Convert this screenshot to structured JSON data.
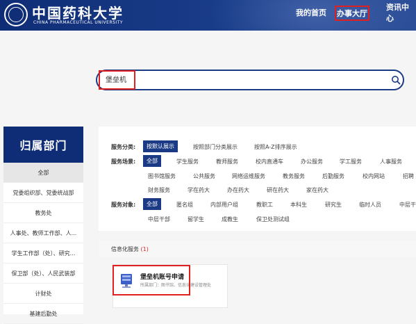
{
  "header": {
    "logo_cn": "中国药科大学",
    "logo_en": "CHINA PHARMACEUTICAL UNIVERSITY",
    "nav": [
      "我的首页",
      "办事大厅",
      "资讯中心"
    ]
  },
  "search": {
    "value": "堡垒机"
  },
  "sidebar": {
    "title": "归属部门",
    "items": [
      "全部",
      "党委组织部、党委统战部",
      "教务处",
      "人事处、教师工作部、人...",
      "学生工作部（处）、研究...",
      "保卫部（处）、人民武装部",
      "计财处",
      "基建后勤处"
    ]
  },
  "filters": {
    "category_label": "服务分类:",
    "category_options": [
      "按默认展示",
      "按照部门分类展示",
      "按照A-Z排序展示"
    ],
    "scene_label": "服务场景:",
    "scene_row1": [
      "全部",
      "学生服务",
      "教师服务",
      "校内直通车",
      "办公服务",
      "学工服务",
      "人事服务"
    ],
    "scene_row2": [
      "图书馆服务",
      "公共服务",
      "网络运维服务",
      "教务服务",
      "后勤服务",
      "校内网站",
      "招聘"
    ],
    "scene_row3": [
      "财务服务",
      "学在药大",
      "办在药大",
      "研在药大",
      "家在药大"
    ],
    "object_label": "服务对象:",
    "object_row1": [
      "全部",
      "匿名组",
      "内部用户组",
      "教职工",
      "本科生",
      "研究生",
      "临时人员",
      "中层干"
    ],
    "object_row2": [
      "中层干部",
      "留学生",
      "成教生",
      "保卫处测试组"
    ]
  },
  "section": {
    "title": "信息化服务",
    "count": "(1)"
  },
  "card": {
    "title": "堡垒机账号申请",
    "subtitle": "所属部门：图书馆、信息化建设管理处",
    "icon": "server-icon"
  }
}
